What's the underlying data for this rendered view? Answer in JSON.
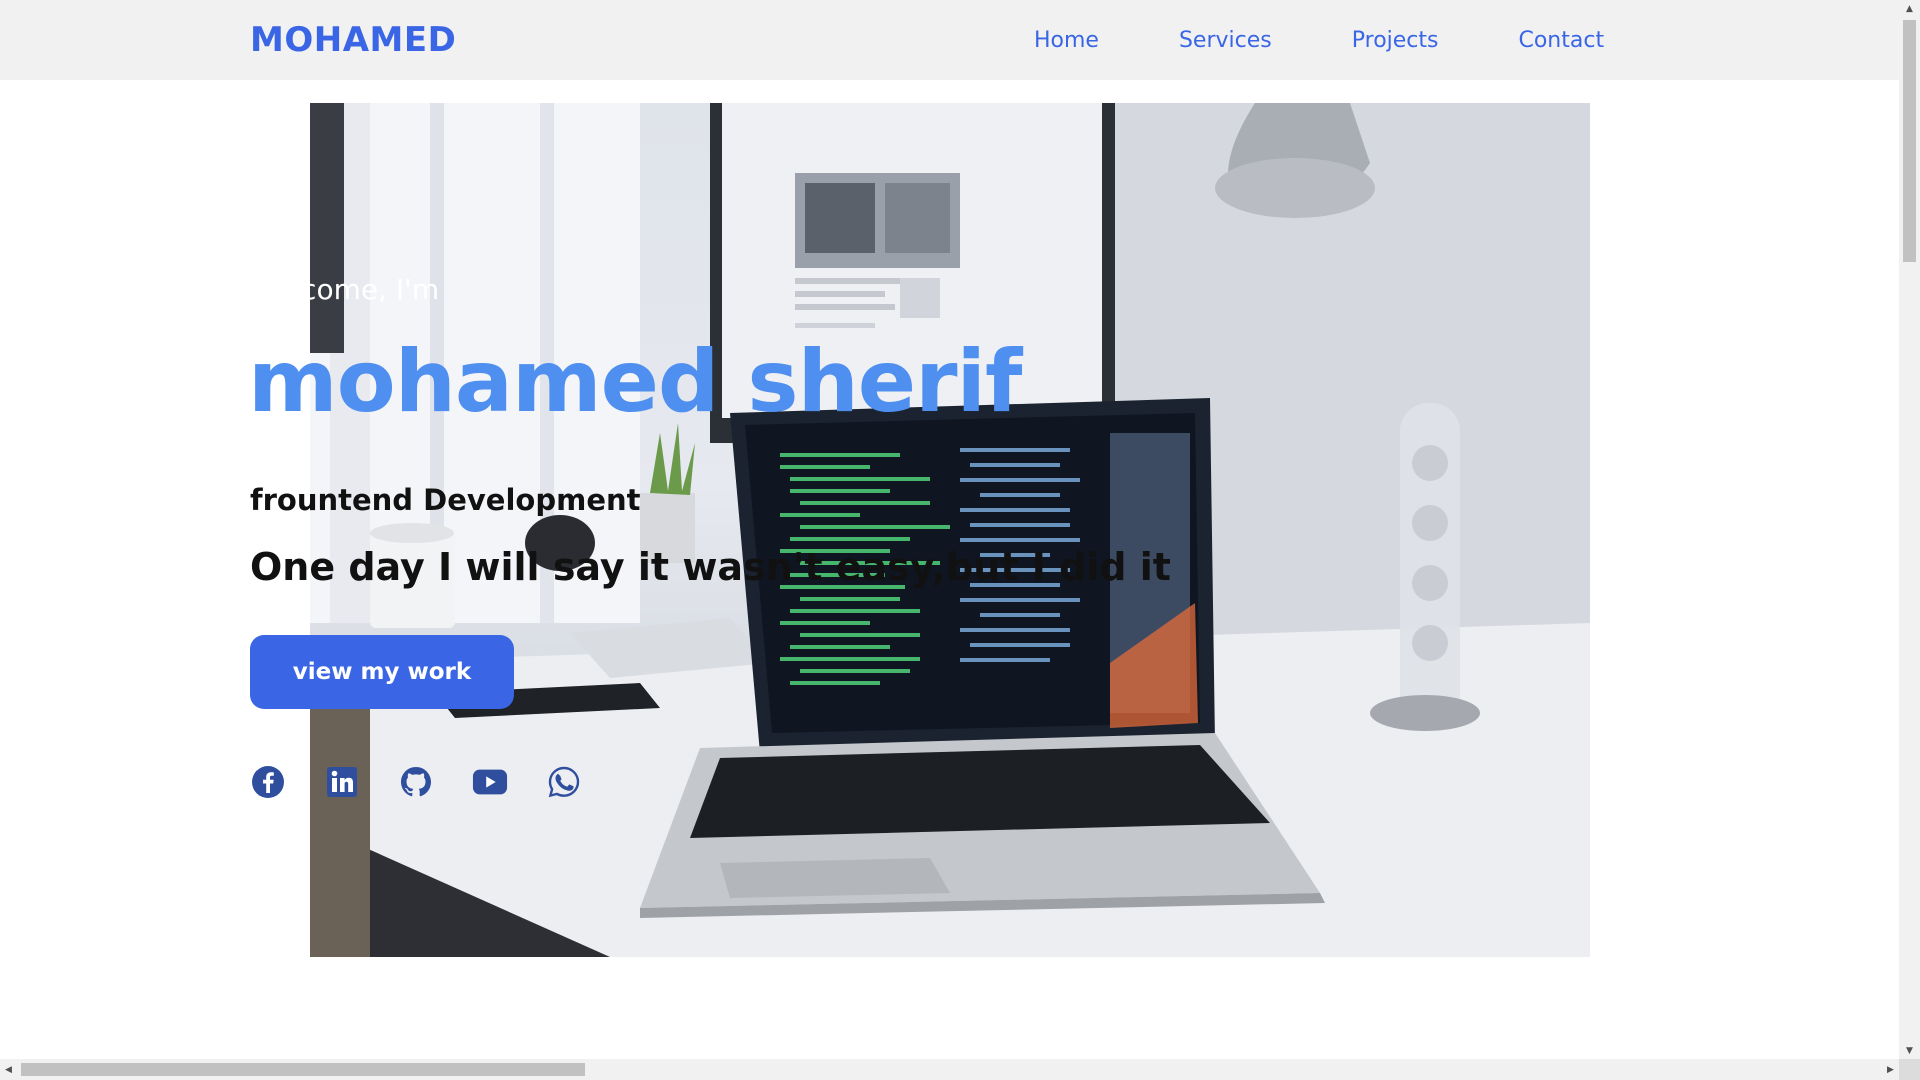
{
  "header": {
    "logo": "MOHAMED",
    "nav": [
      {
        "label": "Home"
      },
      {
        "label": "Services"
      },
      {
        "label": "Projects"
      },
      {
        "label": "Contact"
      }
    ]
  },
  "hero": {
    "welcome": "Welcome, I'm",
    "name": "mohamed sherif",
    "role": "frountend Development",
    "tagline": "One day I will say it wasn't easy,but I did it",
    "cta_label": "view my work",
    "socials": [
      {
        "icon": "facebook-icon"
      },
      {
        "icon": "linkedin-icon"
      },
      {
        "icon": "github-icon"
      },
      {
        "icon": "youtube-icon"
      },
      {
        "icon": "whatsapp-icon"
      }
    ]
  },
  "colors": {
    "accent": "#3a66e6",
    "name": "#4f8ff0",
    "header_bg": "#f1f1f2",
    "social": "#2f4f9e"
  }
}
